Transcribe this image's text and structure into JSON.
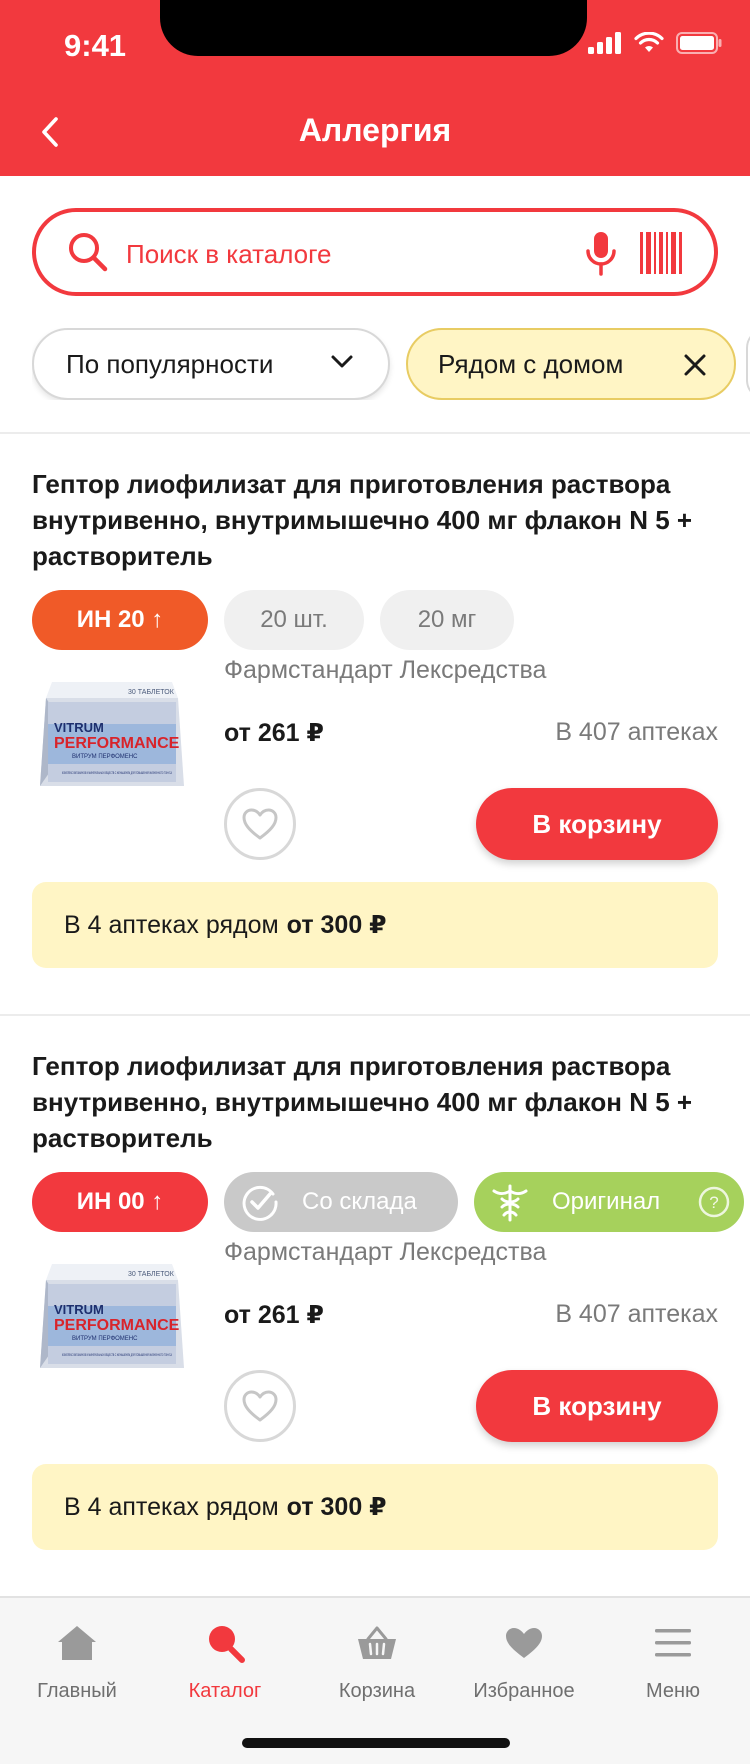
{
  "status_bar": {
    "time": "9:41"
  },
  "header": {
    "title": "Аллергия"
  },
  "search": {
    "placeholder": "Поиск в каталоге"
  },
  "filters": {
    "sort_label": "По популярности",
    "near_label": "Рядом с домом"
  },
  "products": [
    {
      "title": "Гептор лиофилизат для приготовления раствора внутривенно, внутримышечно 400 мг флакон N 5 + растворитель",
      "badge_in": "ИН 20 ↑",
      "badge_in_color": "#f05a28",
      "tag_count": "20 шт.",
      "tag_dose": "20 мг",
      "manufacturer": "Фармстандарт Лексредства",
      "price": "от 261 ₽",
      "availability": "В 407 аптеках",
      "cart_label": "В корзину",
      "nearby_text": "В 4 аптеках рядом",
      "nearby_price": "от 300 ₽"
    },
    {
      "title": "Гептор лиофилизат для приготовления раствора внутривенно, внутримышечно 400 мг флакон N 5 + растворитель",
      "badge_in": "ИН 00 ↑",
      "badge_in_color": "#f2393e",
      "stock_label": "Со склада",
      "original_label": "Оригинал",
      "manufacturer": "Фармстандарт Лексредства",
      "price": "от 261 ₽",
      "availability": "В 407 аптеках",
      "cart_label": "В корзину",
      "nearby_text": "В 4 аптеках рядом",
      "nearby_price": "от 300 ₽"
    }
  ],
  "product_image_text": {
    "count": "30 ТАБЛЕТОК",
    "brand": "VITRUM",
    "line": "PERFORMANCE",
    "sub": "ВИТРУМ ПЕРФОМЕНС",
    "desc": "КОМПЛЕКС ВИТАМИНОВ И МИНЕРАЛЬНЫХ ВЕЩЕСТВ С ЖЕНЬШЕНЕМ ДЛЯ ПОВЫШЕНИЯ ЖИЗНЕННОГО ТОНУСА"
  },
  "tabbar": [
    {
      "label": "Главный",
      "icon": "home-icon"
    },
    {
      "label": "Каталог",
      "icon": "catalog-search-icon"
    },
    {
      "label": "Корзина",
      "icon": "basket-icon"
    },
    {
      "label": "Избранное",
      "icon": "heart-icon"
    },
    {
      "label": "Меню",
      "icon": "menu-icon"
    }
  ],
  "colors": {
    "accent": "#f2393e",
    "highlight_bg": "#fff5c5",
    "original_green": "#a6d15c"
  }
}
